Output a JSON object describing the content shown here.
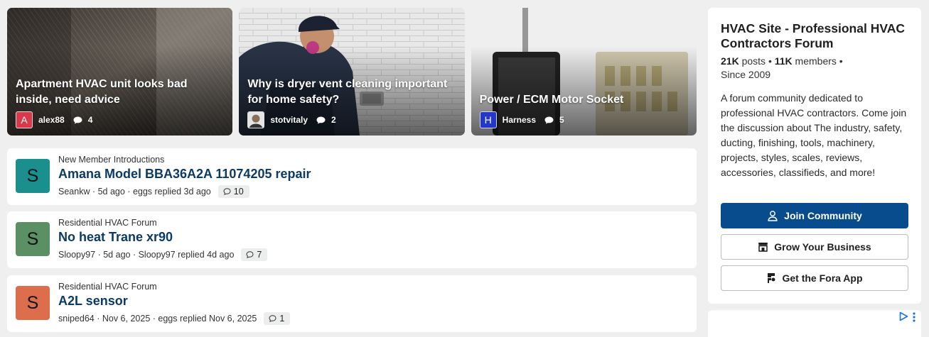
{
  "featured": [
    {
      "title": "Apartment HVAC unit looks bad inside, need advice",
      "avatar_letter": "A",
      "avatar_color": "#d9394a",
      "author": "alex88",
      "comments": "4"
    },
    {
      "title": "Why is dryer vent cleaning important for home safety?",
      "avatar_letter": "",
      "avatar_color": "#6b6b6b",
      "author": "stotvitaly",
      "comments": "2"
    },
    {
      "title": "Power / ECM Motor Socket",
      "avatar_letter": "H",
      "avatar_color": "#2437c8",
      "author": "Harness",
      "comments": "5"
    }
  ],
  "threads": [
    {
      "forum": "New Member Introductions",
      "title": "Amana Model BBA36A2A 11074205 repair",
      "avatar_letter": "S",
      "avatar_color": "#1b8e8e",
      "author": "Seankw",
      "age": "5d ago",
      "last_reply": "eggs replied 3d ago",
      "replies": "10"
    },
    {
      "forum": "Residential HVAC Forum",
      "title": "No heat Trane xr90",
      "avatar_letter": "S",
      "avatar_color": "#5b9064",
      "author": "Sloopy97",
      "age": "5d ago",
      "last_reply": "Sloopy97 replied 4d ago",
      "replies": "7"
    },
    {
      "forum": "Residential HVAC Forum",
      "title": "A2L sensor",
      "avatar_letter": "S",
      "avatar_color": "#dc6e4e",
      "author": "sniped64",
      "age": "Nov 6, 2025",
      "last_reply": "eggs replied Nov 6, 2025",
      "replies": "1"
    }
  ],
  "sidebar": {
    "title": "HVAC Site - Professional HVAC Contractors Forum",
    "posts_count": "21K",
    "posts_label": "posts",
    "members_count": "11K",
    "members_label": "members",
    "since": "Since 2009",
    "description": "A forum community dedicated to professional HVAC contractors. Come join the discussion about The industry, safety, ducting, finishing, tools, machinery, projects, styles, scales, reviews, accessories, classifieds, and more!",
    "join_label": "Join Community",
    "grow_label": "Grow Your Business",
    "app_label": "Get the Fora App"
  },
  "colors": {
    "primary": "#084c8d",
    "thread_title": "#0b3a66",
    "ad_icon": "#1a73e8"
  },
  "icons": [
    "comment-bubble-icon",
    "user-icon",
    "store-icon",
    "fora-app-icon",
    "ad-choices-icon",
    "ad-menu-icon"
  ]
}
